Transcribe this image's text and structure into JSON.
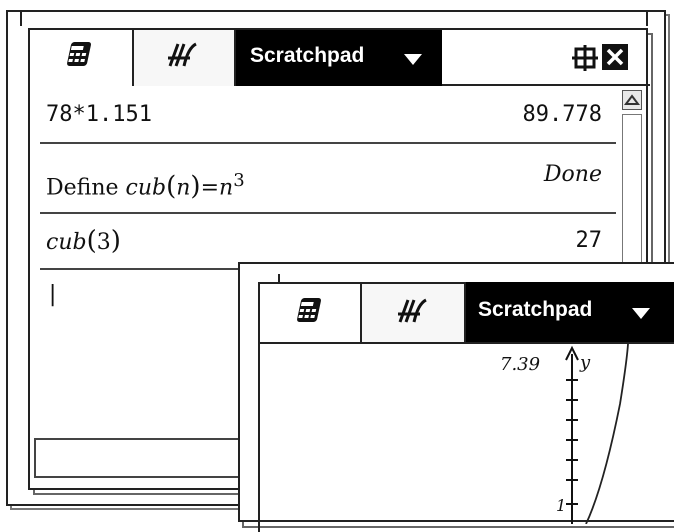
{
  "window1": {
    "tabs": [
      {
        "icon": "calculator-icon"
      },
      {
        "icon": "graph-icon"
      }
    ],
    "title": "Scratchpad",
    "history": [
      {
        "expression": "78*1.151",
        "result": "89.778"
      },
      {
        "expression_prefix": "Define ",
        "expression_fn": "cub",
        "expression_arg": "n",
        "expression_rhs": "n",
        "expression_exp": "3",
        "result": "Done"
      },
      {
        "expression_fn": "cub",
        "expression_arg": "3",
        "result": "27"
      }
    ],
    "input_cursor": "|"
  },
  "window2": {
    "tabs": [
      {
        "icon": "calculator-icon"
      },
      {
        "icon": "graph-icon"
      }
    ],
    "title": "Scratchpad",
    "graph": {
      "y_max_label": "7.39",
      "y_axis_label": "y",
      "tick_label": "1"
    }
  }
}
